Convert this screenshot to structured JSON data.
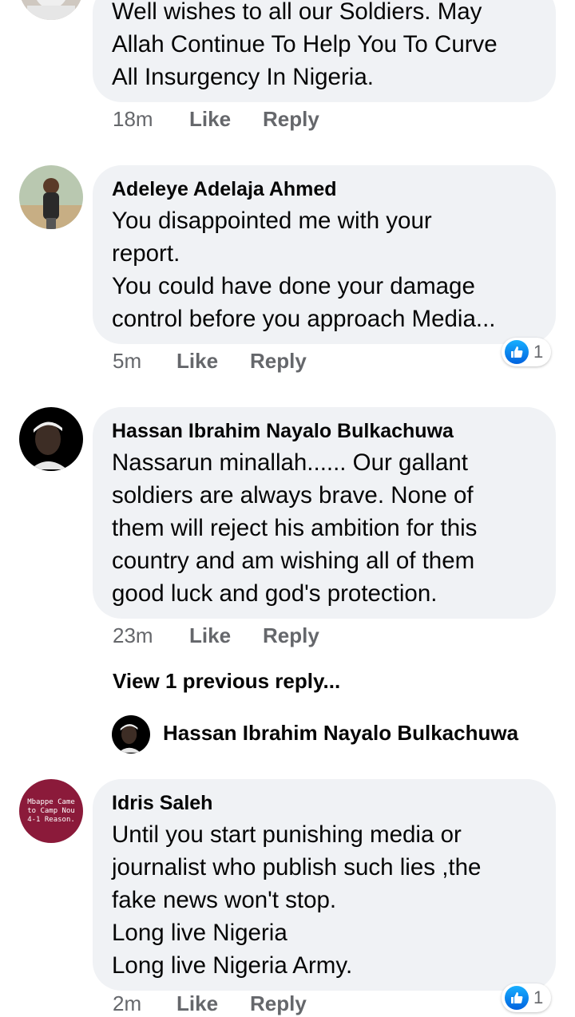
{
  "comments": [
    {
      "author": "",
      "lines": [
        "Well wishes to all our Soldiers. May",
        "Allah Continue To Help You To Curve",
        "All Insurgency In Nigeria."
      ],
      "time": "18m",
      "like": "Like",
      "reply": "Reply"
    },
    {
      "author": "Adeleye Adelaja Ahmed",
      "lines": [
        "You disappointed me with your",
        "report.",
        "You could have done your damage",
        "control before you approach Media..."
      ],
      "time": "5m",
      "like": "Like",
      "reply": "Reply",
      "reactions": "1"
    },
    {
      "author": "Hassan Ibrahim Nayalo Bulkachuwa",
      "lines": [
        "Nassarun minallah...... Our gallant",
        "soldiers are always brave. None of",
        "them will reject his ambition for this",
        "country and am wishing all of them",
        "good luck and god's protection."
      ],
      "time": "23m",
      "like": "Like",
      "reply": "Reply",
      "view_replies": "View 1 previous reply...",
      "reply_preview_author": "Hassan Ibrahim Nayalo Bulkachuwa"
    },
    {
      "author": "Idris Saleh",
      "avatar_text": "Mbappe Came to Camp Nou 4-1 Reason.",
      "lines": [
        "Until you start punishing media or",
        "journalist who publish such lies ,the",
        "fake news won't stop.",
        "Long live Nigeria",
        "Long live Nigeria Army."
      ],
      "time": "2m",
      "like": "Like",
      "reply": "Reply",
      "reactions": "1"
    }
  ],
  "colors": {
    "bubble": "#f0f2f5",
    "meta": "#65676b",
    "like_blue": "#1877f2",
    "idris_avatar": "#8b1a3a"
  }
}
